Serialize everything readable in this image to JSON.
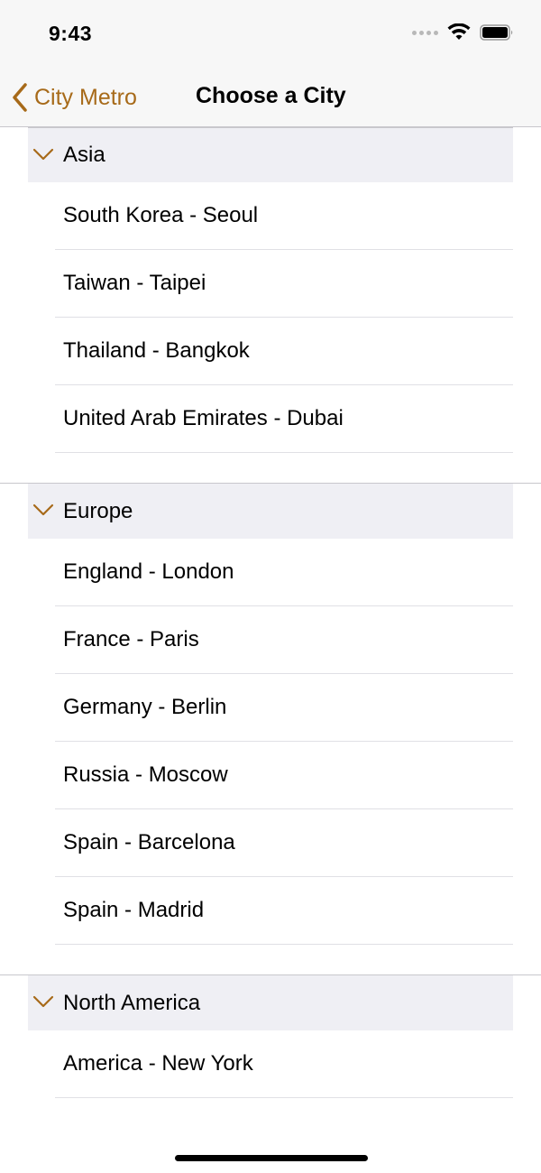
{
  "status_bar": {
    "time": "9:43"
  },
  "nav": {
    "back_label": "City Metro",
    "title": "Choose a City"
  },
  "sections": [
    {
      "title": "Asia",
      "cities": [
        "South Korea - Seoul",
        "Taiwan - Taipei",
        "Thailand - Bangkok",
        "United Arab Emirates - Dubai"
      ]
    },
    {
      "title": "Europe",
      "cities": [
        "England - London",
        "France - Paris",
        "Germany - Berlin",
        "Russia - Moscow",
        "Spain - Barcelona",
        "Spain - Madrid"
      ]
    },
    {
      "title": "North America",
      "cities": [
        "America - New York"
      ]
    }
  ],
  "colors": {
    "accent": "#a76a19",
    "section_bg": "#efeff4",
    "bar_bg": "#f7f7f7"
  },
  "icons": {
    "back": "chevron-left-icon",
    "section_toggle": "chevron-down-icon",
    "wifi": "wifi-icon",
    "battery": "battery-icon",
    "signal": "cellular-signal-icon"
  }
}
